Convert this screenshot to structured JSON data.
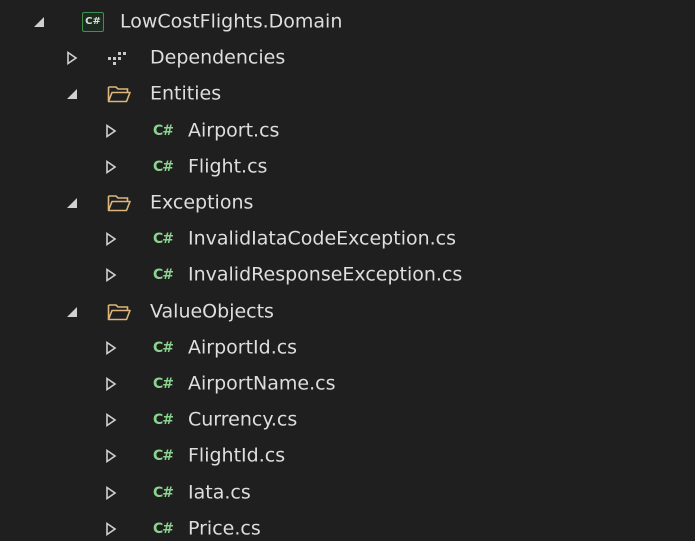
{
  "tree": [
    {
      "label": "LowCostFlights.Domain",
      "level": 0,
      "expanded": true,
      "icon": "csharp-project-icon"
    },
    {
      "label": "Dependencies",
      "level": 1,
      "expanded": false,
      "icon": "dependencies-icon"
    },
    {
      "label": "Entities",
      "level": 1,
      "expanded": true,
      "icon": "folder-open-icon"
    },
    {
      "label": "Airport.cs",
      "level": 2,
      "expanded": false,
      "icon": "csharp-file-icon"
    },
    {
      "label": "Flight.cs",
      "level": 2,
      "expanded": false,
      "icon": "csharp-file-icon"
    },
    {
      "label": "Exceptions",
      "level": 1,
      "expanded": true,
      "icon": "folder-open-icon"
    },
    {
      "label": "InvalidIataCodeException.cs",
      "level": 2,
      "expanded": false,
      "icon": "csharp-file-icon"
    },
    {
      "label": "InvalidResponseException.cs",
      "level": 2,
      "expanded": false,
      "icon": "csharp-file-icon"
    },
    {
      "label": "ValueObjects",
      "level": 1,
      "expanded": true,
      "icon": "folder-open-icon"
    },
    {
      "label": "AirportId.cs",
      "level": 2,
      "expanded": false,
      "icon": "csharp-file-icon"
    },
    {
      "label": "AirportName.cs",
      "level": 2,
      "expanded": false,
      "icon": "csharp-file-icon"
    },
    {
      "label": "Currency.cs",
      "level": 2,
      "expanded": false,
      "icon": "csharp-file-icon"
    },
    {
      "label": "FlightId.cs",
      "level": 2,
      "expanded": false,
      "icon": "csharp-file-icon"
    },
    {
      "label": "Iata.cs",
      "level": 2,
      "expanded": false,
      "icon": "csharp-file-icon"
    },
    {
      "label": "Price.cs",
      "level": 2,
      "expanded": false,
      "icon": "csharp-file-icon"
    }
  ],
  "icons": {
    "csharp_project_text": "C#",
    "csharp_file_text": "C#"
  },
  "colors": {
    "background": "#1f1f1f",
    "text": "#dedede",
    "csharp_green": "#8bd38f",
    "folder_yellow": "#dcb67a"
  }
}
